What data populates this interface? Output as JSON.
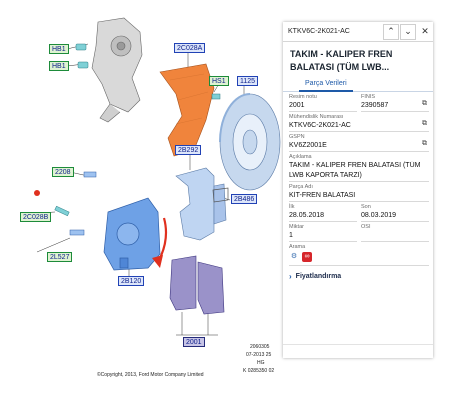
{
  "diagram": {
    "callouts": {
      "hb1_a": "HB1",
      "hb1_b": "HB1",
      "c2c028a": "2C028A",
      "hs1": "HS1",
      "c1125": "1125",
      "c2b292": "2B292",
      "c2208": "2208",
      "c2b486": "2B486",
      "c2c028b": "2C028B",
      "c2l527": "2L527",
      "c2b120": "2B120",
      "c2001": "2001"
    },
    "imprint": {
      "line1": "2060305",
      "line2": "07-2013 25",
      "line3": "HG",
      "line4": "K 0285350 02"
    },
    "copyright": "©Copyright, 2013, Ford Motor Company Limited",
    "colors": {
      "disc": "#c6d8ee",
      "caliper": "#6ea1e6",
      "shield": "#f0843c",
      "pads": "#9a92c9",
      "hub": "#d9d9d9",
      "arrow": "#e0301e"
    }
  },
  "panel": {
    "part_code": "KTKV6C-2K021-AC",
    "controls": {
      "up_icon": "chevron-up-icon",
      "down_icon": "chevron-down-icon",
      "close_icon": "close-icon"
    },
    "title": "TAKIM - KALIPER FREN BALATASI (TÜM LWB...",
    "tab": "Parça Verileri",
    "fields": {
      "ref_label": "Resim notu",
      "ref_value": "2001",
      "finis_label": "FINIS",
      "finis_value": "2390587",
      "eng_label": "Mühendislik Numarası",
      "eng_value": "KTKV6C-2K021-AC",
      "gspn_label": "GSPN",
      "gspn_value": "KV6Z2001E",
      "desc_label": "Açıklama",
      "desc_value": "TAKIM - KALIPER FREN BALATASI (TÜM LWB KAPORTA TARZI)",
      "name_label": "Parça Adı",
      "name_value": "KİT-FREN BALATASI",
      "first_label": "İlk",
      "first_value": "28.05.2018",
      "last_label": "Son",
      "last_value": "08.03.2019",
      "qty_label": "Miktar",
      "qty_value": "1",
      "osi_label": "OSI",
      "osi_value": "",
      "search_label": "Arama"
    },
    "pricing": "Fiyatlandırma"
  }
}
